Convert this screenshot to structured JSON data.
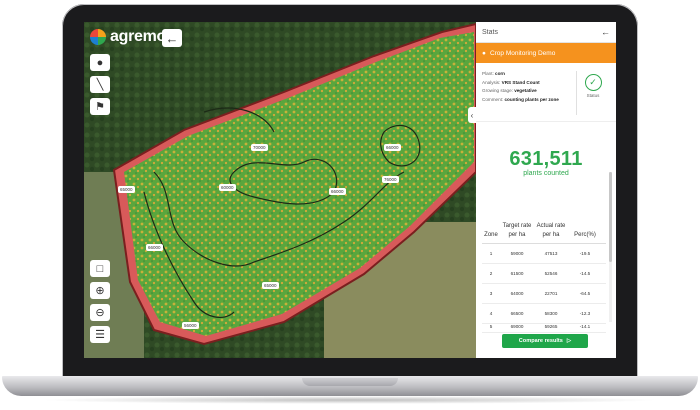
{
  "app": {
    "logo_text": "agremo"
  },
  "map": {
    "back_icon": "arrow-left-icon",
    "tools": [
      "map-pin-icon",
      "ruler-icon",
      "flag-icon"
    ],
    "bottom_tools": [
      "document-icon",
      "zoom-in-icon",
      "zoom-out-icon",
      "layers-icon"
    ],
    "zone_labels": [
      "70000",
      "66000",
      "65000",
      "60000",
      "66000",
      "76000",
      "66000",
      "65000",
      "56000"
    ]
  },
  "panel": {
    "title": "Stats",
    "back_icon": "arrow-left-icon",
    "project_name": "Crop Monitoring Demo",
    "info": {
      "plant_label": "Plant:",
      "plant_value": "corn",
      "analysis_label": "Analysis:",
      "analysis_value": "VRS Stand Count",
      "stage_label": "Growing stage:",
      "stage_value": "vegetative",
      "comment_label": "Comment:",
      "comment_value": "counting plants per zone"
    },
    "status_label": "Status",
    "plants_counted": "631,511",
    "plants_counted_label": "plants counted",
    "table": {
      "headers": [
        "Zone",
        "Target rate per ha",
        "Actual rate per ha",
        "Perc(%)"
      ],
      "rows": [
        [
          "1",
          "59000",
          "47513",
          "-19.5"
        ],
        [
          "2",
          "61500",
          "52546",
          "-14.5"
        ],
        [
          "3",
          "64000",
          "22701",
          "-64.5"
        ],
        [
          "4",
          "66500",
          "58300",
          "-12.3"
        ],
        [
          "5",
          "69000",
          "59265",
          "-14.1"
        ]
      ]
    },
    "compare_button": "Compare results"
  },
  "colors": {
    "accent": "#2fa84f",
    "project_bar": "#f5921e",
    "button": "#1fa64a"
  }
}
